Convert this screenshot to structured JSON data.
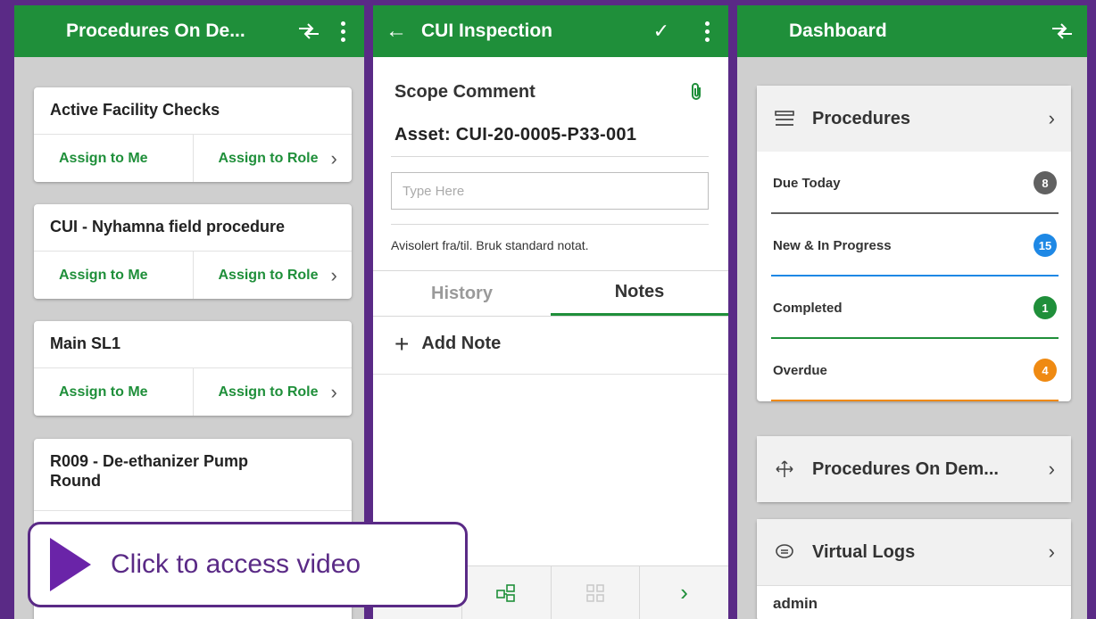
{
  "panel1": {
    "title": "Procedures On De...",
    "cards": [
      {
        "title": "Active Facility Checks",
        "assign_me": "Assign to Me",
        "assign_role": "Assign to Role"
      },
      {
        "title": "CUI - Nyhamna field procedure",
        "assign_me": "Assign to Me",
        "assign_role": "Assign to Role"
      },
      {
        "title": "Main SL1",
        "assign_me": "Assign to Me",
        "assign_role": "Assign to Role"
      },
      {
        "title": "R009 - De-ethanizer Pump Round"
      }
    ]
  },
  "video": {
    "label": "Click to access video"
  },
  "panel2": {
    "title": "CUI Inspection",
    "scope": "Scope Comment",
    "asset": "Asset:  CUI-20-0005-P33-001",
    "input_placeholder": "Type Here",
    "note": "Avisolert fra/til. Bruk standard notat.",
    "tabs": {
      "history": "History",
      "notes": "Notes"
    },
    "add_note": "Add Note"
  },
  "panel3": {
    "title": "Dashboard",
    "procedures": {
      "label": "Procedures",
      "rows": [
        {
          "label": "Due Today",
          "count": "8",
          "color": "#616161"
        },
        {
          "label": "New & In Progress",
          "count": "15",
          "color": "#1e88e5"
        },
        {
          "label": "Completed",
          "count": "1",
          "color": "#1f8f3a"
        },
        {
          "label": "Overdue",
          "count": "4",
          "color": "#ef8a12"
        }
      ]
    },
    "on_demand": {
      "label": "Procedures On Dem..."
    },
    "virtual_logs": {
      "label": "Virtual Logs",
      "user": "admin"
    }
  },
  "colors": {
    "accent": "#1f8f3a",
    "frame": "#5a2a86"
  }
}
